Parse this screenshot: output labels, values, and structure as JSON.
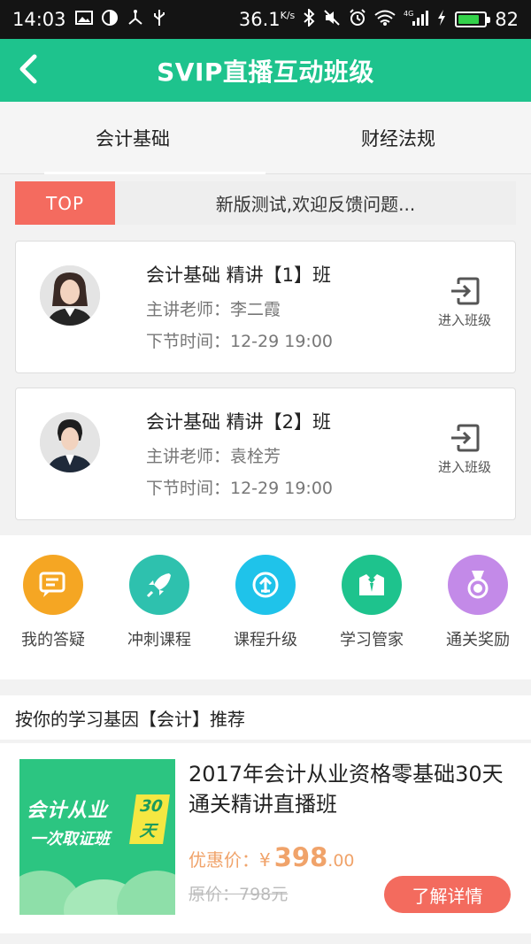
{
  "status_bar": {
    "time": "14:03",
    "speed": "36.1",
    "speed_unit": "K/s",
    "network": "4G",
    "battery": "82",
    "battery_level": 0.82
  },
  "header": {
    "title": "SVIP直播互动班级",
    "back_icon": "back-arrow-icon"
  },
  "tabs": [
    {
      "label": "会计基础",
      "active": true
    },
    {
      "label": "财经法规",
      "active": false
    }
  ],
  "notice": {
    "tag": "TOP",
    "text": "新版测试,欢迎反馈问题..."
  },
  "classes": [
    {
      "name": "会计基础 精讲【1】班",
      "teacher": "主讲老师：李二霞",
      "next_time": "下节时间：12-29 19:00",
      "enter_label": "进入班级"
    },
    {
      "name": "会计基础 精讲【2】班",
      "teacher": "主讲老师：袁栓芳",
      "next_time": "下节时间：12-29 19:00",
      "enter_label": "进入班级"
    }
  ],
  "features": [
    {
      "label": "我的答疑",
      "icon": "chat-icon",
      "color": "#f5a623"
    },
    {
      "label": "冲刺课程",
      "icon": "rocket-icon",
      "color": "#2ec1ae"
    },
    {
      "label": "课程升级",
      "icon": "upgrade-icon",
      "color": "#1fc3ea"
    },
    {
      "label": "学习管家",
      "icon": "butler-icon",
      "color": "#1ec38d"
    },
    {
      "label": "通关奖励",
      "icon": "medal-icon",
      "color": "#c38ae8"
    }
  ],
  "recommend": {
    "header": "按你的学习基因【会计】推荐"
  },
  "product": {
    "poster_line1": "会计从业",
    "poster_line2": "一次取证班",
    "poster_badge": "30天",
    "title": "2017年会计从业资格零基础30天通关精讲直播班",
    "price_label": "优惠价：",
    "currency": "¥",
    "price_int": "398",
    "price_dec": ".00",
    "original_price": "原价：798元",
    "detail_button": "了解详情"
  },
  "colors": {
    "brand_green": "#1ec38d",
    "top_tag": "#f46b5f",
    "price": "#f0a36a"
  }
}
